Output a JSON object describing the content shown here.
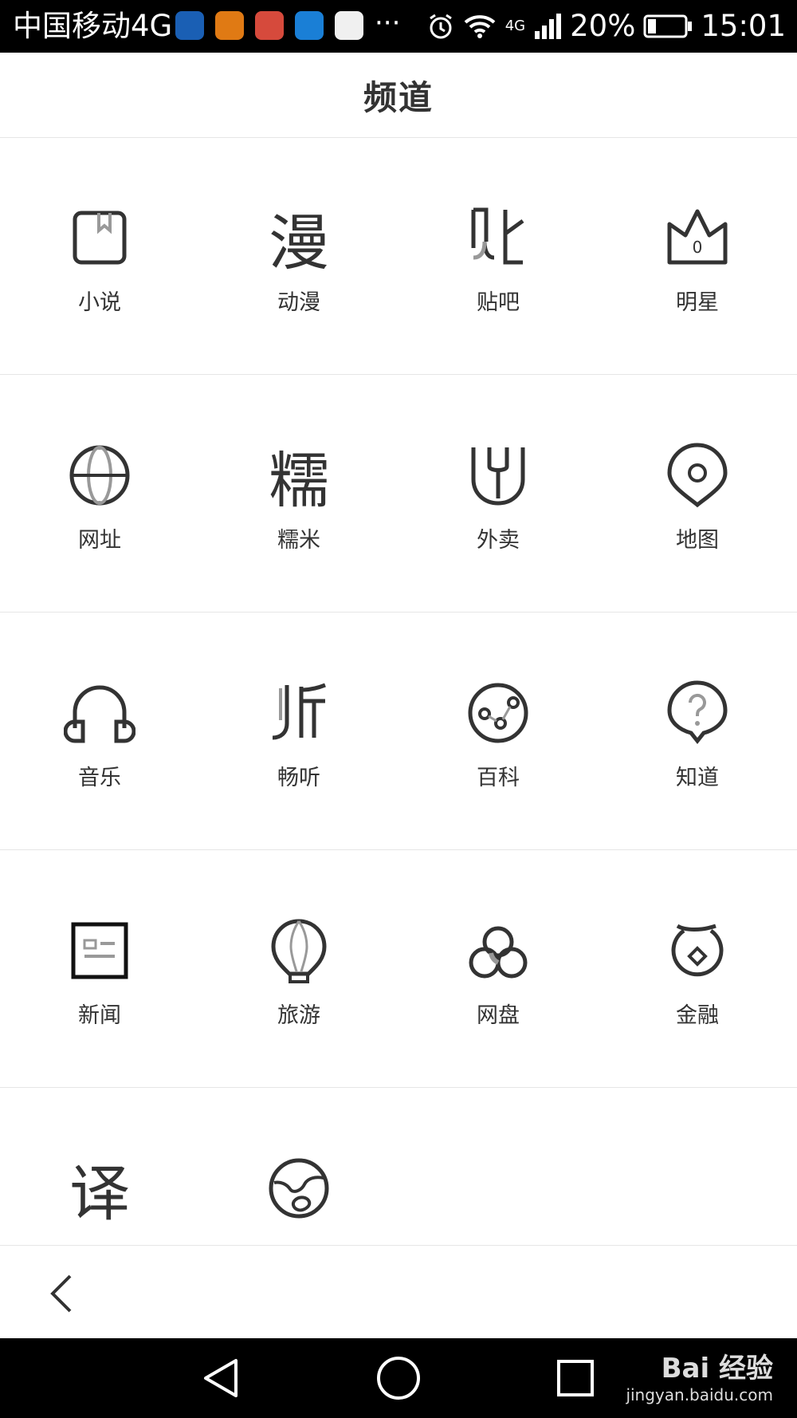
{
  "status": {
    "carrier": "中国移动4G",
    "more": "···",
    "network": "4G",
    "battery": "20%",
    "time": "15:01",
    "app_icon_colors": [
      "#1a5fb4",
      "#e07a14",
      "#d64a3c",
      "#1a7fd6",
      "#f0f0f0"
    ]
  },
  "header": {
    "title": "频道"
  },
  "rows": [
    [
      {
        "label": "小说",
        "icon": "book-icon"
      },
      {
        "label": "动漫",
        "icon": "manga-icon"
      },
      {
        "label": "贴吧",
        "icon": "tieba-icon"
      },
      {
        "label": "明星",
        "icon": "crown-icon"
      }
    ],
    [
      {
        "label": "网址",
        "icon": "globe-icon"
      },
      {
        "label": "糯米",
        "icon": "nuomi-icon"
      },
      {
        "label": "外卖",
        "icon": "fork-icon"
      },
      {
        "label": "地图",
        "icon": "map-pin-icon"
      }
    ],
    [
      {
        "label": "音乐",
        "icon": "headphones-icon"
      },
      {
        "label": "畅听",
        "icon": "listen-icon"
      },
      {
        "label": "百科",
        "icon": "baike-icon"
      },
      {
        "label": "知道",
        "icon": "question-icon"
      }
    ],
    [
      {
        "label": "新闻",
        "icon": "news-icon"
      },
      {
        "label": "旅游",
        "icon": "balloon-icon"
      },
      {
        "label": "网盘",
        "icon": "cloud-disk-icon"
      },
      {
        "label": "金融",
        "icon": "finance-icon"
      }
    ],
    [
      {
        "label": "",
        "icon": "translate-icon"
      },
      {
        "label": "",
        "icon": "earth-icon"
      }
    ]
  ],
  "glyphs": {
    "manga": "漫",
    "nuomi": "糯",
    "translate": "译",
    "crown_zero": "0"
  },
  "watermark": {
    "line1": "Bai 经验",
    "line2": "jingyan.baidu.com"
  },
  "colors": {
    "icon_stroke": "#333333",
    "divider": "#e6e6e6",
    "accent_gray": "#999999"
  }
}
